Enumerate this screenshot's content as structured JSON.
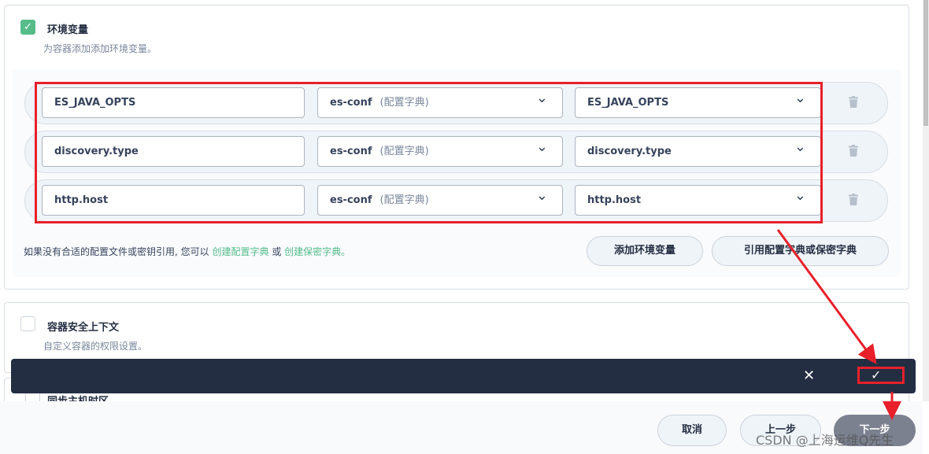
{
  "env_section": {
    "checked": true,
    "title": "环境变量",
    "description": "为容器添加添加环境变量。",
    "rows": [
      {
        "name": "ES_JAVA_OPTS",
        "source": "es-conf",
        "source_type": "(配置字典)",
        "key": "ES_JAVA_OPTS"
      },
      {
        "name": "discovery.type",
        "source": "es-conf",
        "source_type": "(配置字典)",
        "key": "discovery.type"
      },
      {
        "name": "http.host",
        "source": "es-conf",
        "source_type": "(配置字典)",
        "key": "http.host"
      }
    ],
    "hint_prefix": "如果没有合适的配置文件或密钥引用, 您可以",
    "hint_link1": "创建配置字典",
    "hint_or": "或",
    "hint_link2": "创建保密字典",
    "hint_suffix": "。",
    "add_button": "添加环境变量",
    "ref_button": "引用配置字典或保密字典"
  },
  "security_section": {
    "checked": false,
    "title": "容器安全上下文",
    "description": "自定义容器的权限设置。"
  },
  "timezone_section": {
    "title": "同步主机时区"
  },
  "footer": {
    "cancel": "取消",
    "prev": "上一步",
    "next": "下一步"
  },
  "watermark": "CSDN @上海运维Q先生",
  "colors": {
    "accent": "#55bc8a",
    "dark_bar": "#242e42",
    "annotation": "#e8202a"
  }
}
